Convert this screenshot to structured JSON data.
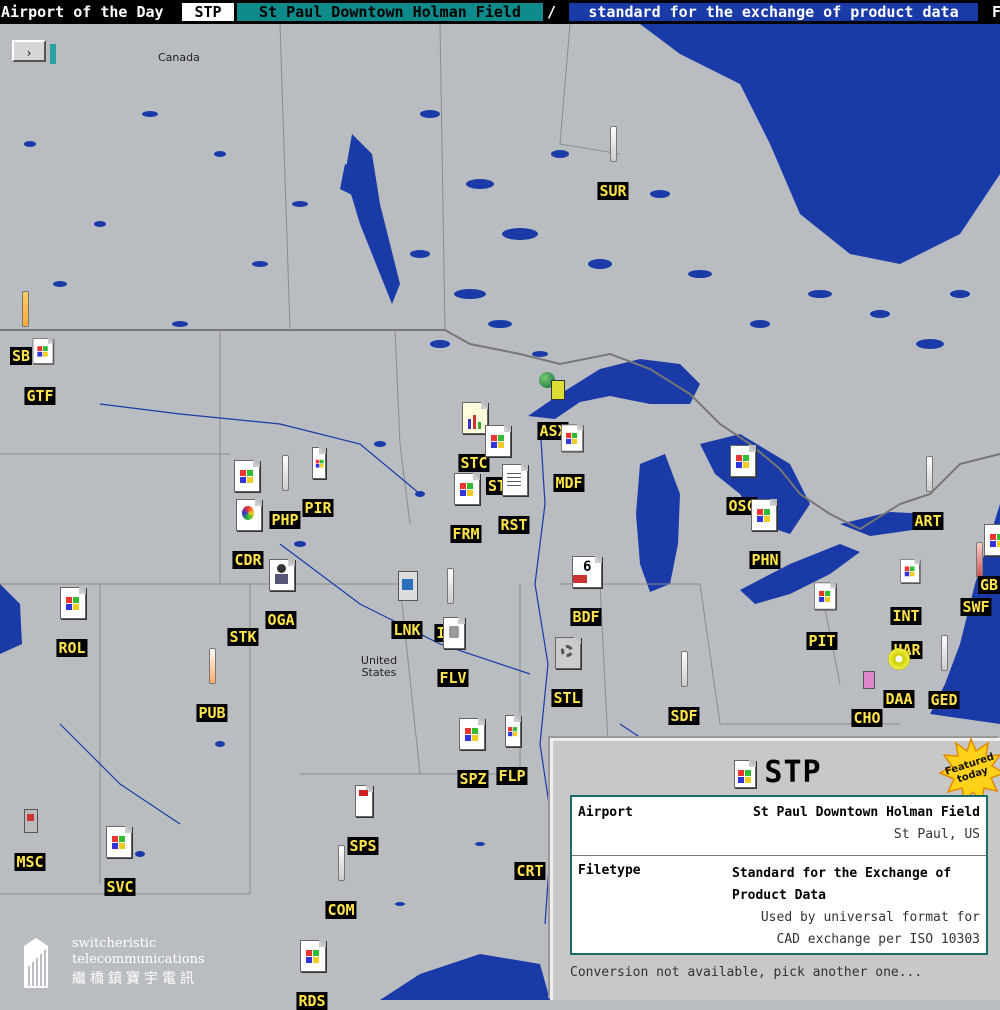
{
  "topbar": {
    "title": "Airport of the Day",
    "code": "STP",
    "airport_name": "St Paul Downtown Holman Field",
    "separator": "/",
    "filetype": "standard for the exchange of product data",
    "overflow": "F"
  },
  "map": {
    "nav_button": "›",
    "labels": {
      "canada": "Canada",
      "usa": "United States"
    },
    "colors": {
      "land": "#b9bcc0",
      "water": "#1a3aa8",
      "border": "#888888"
    },
    "airports": [
      {
        "code": "SUR",
        "icon": "thin-file-icon"
      },
      {
        "code": "SB",
        "icon": "thin-file-icon"
      },
      {
        "code": "GTF",
        "icon": "windows-file-icon"
      },
      {
        "code": "ASX",
        "icon": "globe-user-icon"
      },
      {
        "code": "STC",
        "icon": "chart-file-icon"
      },
      {
        "code": "ST",
        "icon": "windows-file-icon"
      },
      {
        "code": "MDF",
        "icon": "windows-file-icon"
      },
      {
        "code": "FRM",
        "icon": "windows-file-icon"
      },
      {
        "code": "RST",
        "icon": "text-file-icon"
      },
      {
        "code": "PHP",
        "icon": "thin-file-icon"
      },
      {
        "code": "PIR",
        "icon": "thin-file-icon"
      },
      {
        "code": "CDR",
        "icon": "balloon-file-icon"
      },
      {
        "code": "OSC",
        "icon": "windows-file-icon"
      },
      {
        "code": "PHN",
        "icon": "windows-file-icon"
      },
      {
        "code": "ART",
        "icon": "thin-file-icon"
      },
      {
        "code": "OGA",
        "icon": "person-file-icon"
      },
      {
        "code": "STK",
        "icon": "none"
      },
      {
        "code": "LNK",
        "icon": "shortcut-file-icon"
      },
      {
        "code": "IGL",
        "icon": "thin-file-icon"
      },
      {
        "code": "BDF",
        "icon": "font-file-icon"
      },
      {
        "code": "ROL",
        "icon": "windows-file-icon"
      },
      {
        "code": "FLV",
        "icon": "media-file-icon"
      },
      {
        "code": "PIT",
        "icon": "windows-file-icon"
      },
      {
        "code": "INT",
        "icon": "windows-file-icon"
      },
      {
        "code": "HAR",
        "icon": "none"
      },
      {
        "code": "SWF",
        "icon": "thin-file-icon"
      },
      {
        "code": "GB",
        "icon": "windows-file-icon"
      },
      {
        "code": "PUB",
        "icon": "thin-file-icon"
      },
      {
        "code": "STL",
        "icon": "gear-file-icon"
      },
      {
        "code": "SDF",
        "icon": "thin-file-icon"
      },
      {
        "code": "DAA",
        "icon": "disc-icon"
      },
      {
        "code": "CHO",
        "icon": "small-file-icon"
      },
      {
        "code": "GED",
        "icon": "thin-file-icon"
      },
      {
        "code": "SPZ",
        "icon": "windows-file-icon"
      },
      {
        "code": "FLP",
        "icon": "windows-file-icon"
      },
      {
        "code": "MSC",
        "icon": "tool-file-icon"
      },
      {
        "code": "SPS",
        "icon": "red-file-icon"
      },
      {
        "code": "SVC",
        "icon": "windows-file-icon"
      },
      {
        "code": "CRT",
        "icon": "none"
      },
      {
        "code": "COM",
        "icon": "thin-file-icon"
      },
      {
        "code": "RDS",
        "icon": "windows-file-icon"
      }
    ]
  },
  "panel": {
    "code": "STP",
    "badge": "Featured today",
    "airport_label": "Airport",
    "airport_value": "St Paul Downtown Holman Field",
    "airport_location": "St Paul, US",
    "filetype_label": "Filetype",
    "filetype_value_line1": "Standard for the Exchange of",
    "filetype_value_line2": "Product Data",
    "filetype_desc_line1": "Used by universal format for",
    "filetype_desc_line2": "CAD exchange per ISO 10303",
    "footer": "Conversion not available, pick another one..."
  },
  "logo": {
    "line1": "switcheristic",
    "line2": "telecommunications",
    "cjk": "繼橋鎮寶宇電訊"
  }
}
